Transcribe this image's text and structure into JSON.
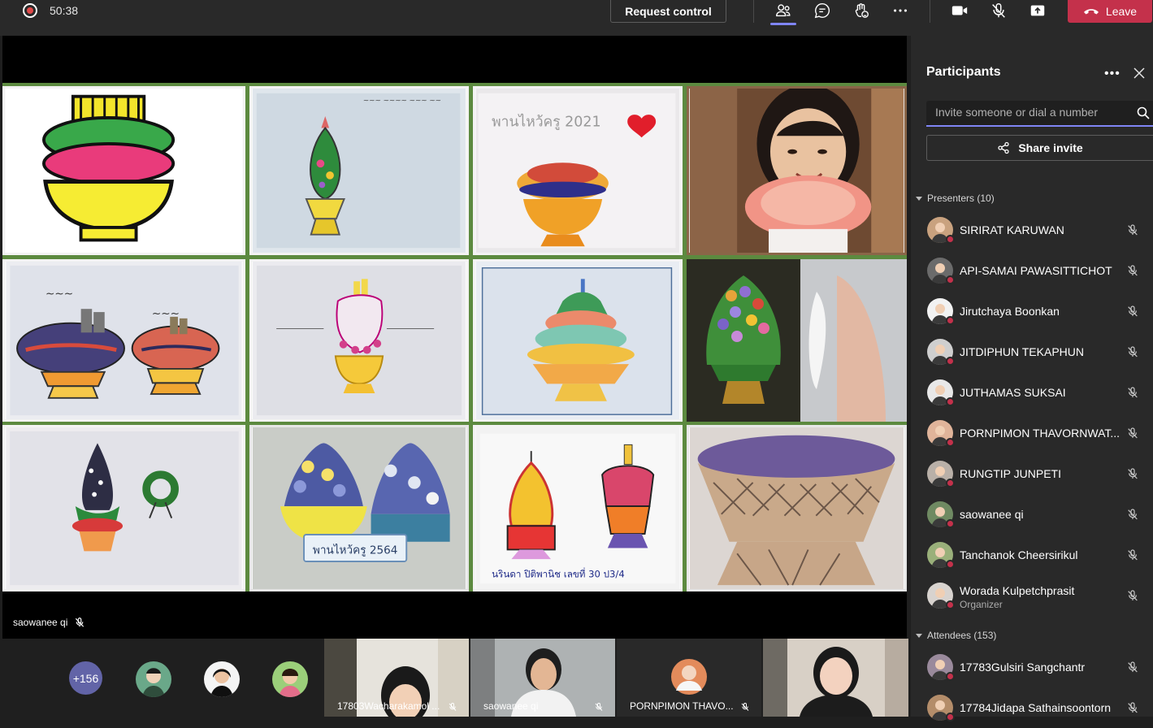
{
  "topbar": {
    "timer": "50:38",
    "request_control_label": "Request control",
    "icons": [
      "participants-icon",
      "chat-icon",
      "reactions-icon",
      "more-actions-icon",
      "camera-icon",
      "mic-off-icon",
      "share-screen-icon"
    ],
    "leave_label": "Leave",
    "leave_color": "#c4314b",
    "accent_color": "#7f85f5"
  },
  "stage": {
    "speaker_label": "saowanee qi",
    "tiles": [
      {
        "caption": ""
      },
      {
        "caption": ""
      },
      {
        "caption": "พานไหว้ครู 2021"
      },
      {
        "caption": ""
      },
      {
        "caption": ""
      },
      {
        "caption": ""
      },
      {
        "caption": ""
      },
      {
        "caption": ""
      },
      {
        "caption": ""
      },
      {
        "caption": "พานไหว้ครู 2564"
      },
      {
        "caption": "นรินดา ปิติพานิช เลขที่ 30 ป3/4"
      },
      {
        "caption": ""
      }
    ]
  },
  "strip": {
    "more_count": "+156",
    "videos": [
      {
        "name": "17803Wacharakamol ..."
      },
      {
        "name": "saowanee qi"
      },
      {
        "name": "PORNPIMON THAVO..."
      },
      {
        "name": ""
      }
    ]
  },
  "panel": {
    "title": "Participants",
    "search_placeholder": "Invite someone or dial a number",
    "share_invite_label": "Share invite",
    "presenters_header": "Presenters (10)",
    "attendees_header": "Attendees (153)",
    "presenters": [
      {
        "name": "SIRIRAT KARUWAN",
        "role": ""
      },
      {
        "name": "API-SAMAI PAWASITTICHOT",
        "role": ""
      },
      {
        "name": "Jirutchaya Boonkan",
        "role": ""
      },
      {
        "name": "JITDIPHUN TEKAPHUN",
        "role": ""
      },
      {
        "name": "JUTHAMAS SUKSAI",
        "role": ""
      },
      {
        "name": "PORNPIMON THAVORNWAT...",
        "role": ""
      },
      {
        "name": "RUNGTIP JUNPETI",
        "role": ""
      },
      {
        "name": "saowanee qi",
        "role": ""
      },
      {
        "name": "Tanchanok Cheersirikul",
        "role": ""
      },
      {
        "name": "Worada Kulpetchprasit",
        "role": "Organizer"
      }
    ],
    "attendees": [
      {
        "name": "17783Gulsiri Sangchantr",
        "role": ""
      },
      {
        "name": "17784Jidapa Sathainsoontorn",
        "role": ""
      }
    ]
  }
}
